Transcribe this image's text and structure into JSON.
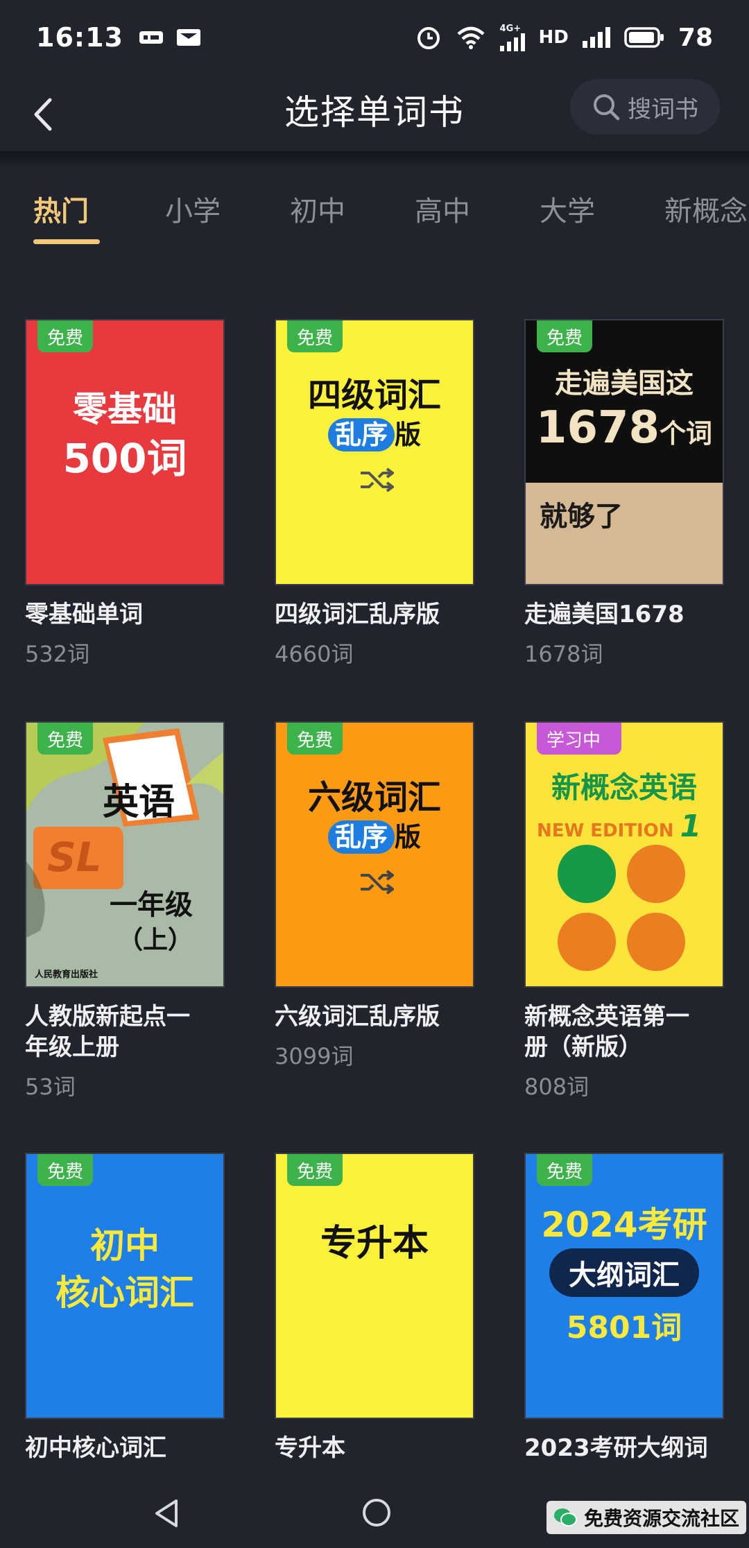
{
  "status_bar": {
    "time": "16:13",
    "network_label": "4G+",
    "hd_label": "HD",
    "battery": "78"
  },
  "header": {
    "title": "选择单词书",
    "search_label": "搜词书"
  },
  "tabs": [
    {
      "label": "热门",
      "active": true
    },
    {
      "label": "小学"
    },
    {
      "label": "初中"
    },
    {
      "label": "高中"
    },
    {
      "label": "大学"
    },
    {
      "label": "新概念"
    }
  ],
  "books": [
    {
      "title": "零基础单词",
      "count": "532词",
      "badge": "免费",
      "cover": {
        "line1": "零基础",
        "line2": "500词"
      }
    },
    {
      "title": "四级词汇乱序版",
      "count": "4660词",
      "badge": "免费",
      "cover": {
        "line1": "四级词汇",
        "pill": "乱序",
        "suffix": "版"
      }
    },
    {
      "title": "走遍美国1678",
      "count": "1678词",
      "badge": "免费",
      "cover": {
        "line1": "走遍美国这",
        "num": "1678",
        "unit": "个词",
        "line3": "就够了"
      }
    },
    {
      "title": "人教版新起点一年级上册",
      "title_line1": "人教版新起点一",
      "title_line2": "年级上册",
      "count": "53词",
      "badge": "免费",
      "cover": {
        "subject": "英语",
        "sl": "SL",
        "grade": "一年级",
        "term": "（上）",
        "publisher": "人民教育出版社"
      }
    },
    {
      "title": "六级词汇乱序版",
      "count": "3099词",
      "badge": "免费",
      "cover": {
        "line1": "六级词汇",
        "pill": "乱序",
        "suffix": "版"
      }
    },
    {
      "title": "新概念英语第一册（新版）",
      "title_line1": "新概念英语第一",
      "title_line2": "册（新版）",
      "count": "808词",
      "badge": "学习中",
      "cover": {
        "line1": "新概念英语",
        "edition": "NEW EDITION",
        "vol": "1"
      }
    },
    {
      "title": "初中核心词汇",
      "count": "",
      "badge": "免费",
      "cover": {
        "line1": "初中",
        "line2": "核心词汇"
      }
    },
    {
      "title": "专升本",
      "count": "",
      "badge": "免费",
      "cover": {
        "line1": "专升本"
      }
    },
    {
      "title": "2023考研大纲词",
      "count": "",
      "badge": "免费",
      "cover": {
        "line1": "2024考研",
        "pill": "大纲词汇",
        "line3": "5801词"
      }
    }
  ],
  "watermark": {
    "text": "免费资源交流社区"
  },
  "colors": {
    "background": "#21232d",
    "accent": "#f2c879",
    "free_badge": "#3db24a",
    "learning_badge": "#c759d6"
  }
}
